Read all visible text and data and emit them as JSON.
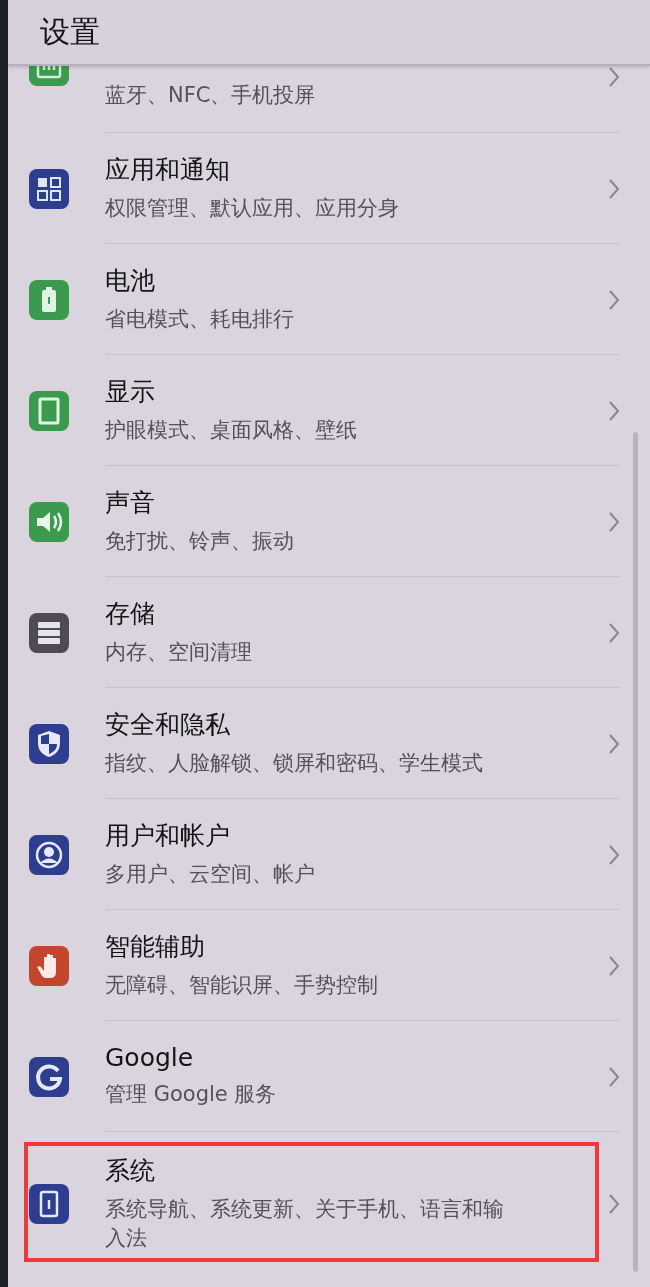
{
  "header": {
    "title": "设置"
  },
  "items": [
    {
      "kind": "network",
      "color": "#3c9a4e",
      "subtitle": "蓝牙、NFC、手机投屏",
      "highlighted": false
    },
    {
      "kind": "apps",
      "color": "#2f3d8f",
      "title": "应用和通知",
      "subtitle": "权限管理、默认应用、应用分身",
      "highlighted": false
    },
    {
      "kind": "battery",
      "color": "#3c9a4e",
      "title": "电池",
      "subtitle": "省电模式、耗电排行",
      "highlighted": false
    },
    {
      "kind": "display",
      "color": "#3c9a4e",
      "title": "显示",
      "subtitle": "护眼模式、桌面风格、壁纸",
      "highlighted": false
    },
    {
      "kind": "sound",
      "color": "#3c9a4e",
      "title": "声音",
      "subtitle": "免打扰、铃声、振动",
      "highlighted": false
    },
    {
      "kind": "storage",
      "color": "#4e4a57",
      "title": "存储",
      "subtitle": "内存、空间清理",
      "highlighted": false
    },
    {
      "kind": "security",
      "color": "#2f3d8f",
      "title": "安全和隐私",
      "subtitle": "指纹、人脸解锁、锁屏和密码、学生模式",
      "highlighted": false
    },
    {
      "kind": "accounts",
      "color": "#2f3d8f",
      "title": "用户和帐户",
      "subtitle": "多用户、云空间、帐户",
      "highlighted": false
    },
    {
      "kind": "assist",
      "color": "#c2452e",
      "title": "智能辅助",
      "subtitle": "无障碍、智能识屏、手势控制",
      "highlighted": false
    },
    {
      "kind": "google",
      "color": "#2f3d8f",
      "title": "Google",
      "subtitle": "管理 Google 服务",
      "highlighted": false
    },
    {
      "kind": "system",
      "color": "#2f3d8f",
      "title": "系统",
      "subtitle": "系统导航、系统更新、关于手机、语言和输入法",
      "highlighted": true
    }
  ]
}
